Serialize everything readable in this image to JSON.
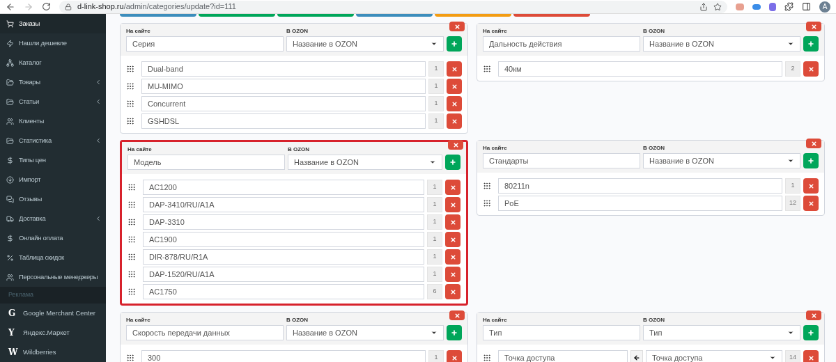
{
  "browser": {
    "url_host": "d-link-shop.ru",
    "url_path": "/admin/categories/update?id=111",
    "avatar": "A"
  },
  "sidebar": {
    "items": [
      {
        "label": "Заказы",
        "selected": true,
        "submenu": false
      },
      {
        "label": "Нашли дешевле",
        "selected": false,
        "submenu": false
      },
      {
        "label": "Каталог",
        "selected": false,
        "submenu": false
      },
      {
        "label": "Товары",
        "selected": false,
        "submenu": true
      },
      {
        "label": "Статьи",
        "selected": false,
        "submenu": true
      },
      {
        "label": "Клиенты",
        "selected": false,
        "submenu": false
      },
      {
        "label": "Статистика",
        "selected": false,
        "submenu": true
      },
      {
        "label": "Типы цен",
        "selected": false,
        "submenu": false
      },
      {
        "label": "Импорт",
        "selected": false,
        "submenu": false
      },
      {
        "label": "Отзывы",
        "selected": false,
        "submenu": false
      },
      {
        "label": "Доставка",
        "selected": false,
        "submenu": true
      },
      {
        "label": "Онлайн оплата",
        "selected": false,
        "submenu": false
      },
      {
        "label": "Таблица скидок",
        "selected": false,
        "submenu": false
      },
      {
        "label": "Персональные менеджеры",
        "selected": false,
        "submenu": false
      }
    ],
    "section": "Реклама",
    "ads_items": [
      {
        "glyph": "G",
        "label": "Google Merchant Center"
      },
      {
        "glyph": "Y",
        "label": "Яндекс.Маркет"
      },
      {
        "glyph": "W",
        "label": "Wildberries"
      }
    ]
  },
  "toolbar_buttons": [
    {
      "color": "#3c8dbc"
    },
    {
      "color": "#00a65a"
    },
    {
      "color": "#00a65a"
    },
    {
      "color": "#3c8dbc"
    },
    {
      "color": "#f39c12"
    },
    {
      "color": "#dd4b39"
    }
  ],
  "cards": [
    {
      "site_label": "На сайте",
      "ozon_label": "В OZON",
      "site_value": "Серия",
      "ozon_value": "Название в OZON",
      "highlighted": false,
      "rows": [
        {
          "kind": "plain",
          "value": "Dual-band",
          "count": "1"
        },
        {
          "kind": "plain",
          "value": "MU-MIMO",
          "count": "1"
        },
        {
          "kind": "plain",
          "value": "Concurrent",
          "count": "1"
        },
        {
          "kind": "plain",
          "value": "GSHDSL",
          "count": "1"
        }
      ]
    },
    {
      "site_label": "На сайте",
      "ozon_label": "В OZON",
      "site_value": "Дальность действия",
      "ozon_value": "Название в OZON",
      "highlighted": false,
      "rows": [
        {
          "kind": "plain",
          "value": "40км",
          "count": "2"
        }
      ]
    },
    {
      "site_label": "На сайте",
      "ozon_label": "В OZON",
      "site_value": "Модель",
      "ozon_value": "Название в OZON",
      "highlighted": true,
      "rows": [
        {
          "kind": "plain",
          "value": "AC1200",
          "count": "1"
        },
        {
          "kind": "plain",
          "value": "DAP-3410/RU/A1A",
          "count": "1"
        },
        {
          "kind": "plain",
          "value": "DAP-3310",
          "count": "1"
        },
        {
          "kind": "plain",
          "value": "AC1900",
          "count": "1"
        },
        {
          "kind": "plain",
          "value": "DIR-878/RU/R1A",
          "count": "1"
        },
        {
          "kind": "plain",
          "value": "DAP-1520/RU/A1A",
          "count": "1"
        },
        {
          "kind": "plain",
          "value": "AC1750",
          "count": "6"
        }
      ]
    },
    {
      "site_label": "На сайте",
      "ozon_label": "В OZON",
      "site_value": "Стандарты",
      "ozon_value": "Название в OZON",
      "highlighted": false,
      "rows": [
        {
          "kind": "plain",
          "value": "80211n",
          "count": "1"
        },
        {
          "kind": "plain",
          "value": "PoE",
          "count": "12"
        }
      ]
    },
    {
      "site_label": "На сайте",
      "ozon_label": "В OZON",
      "site_value": "Скорость передачи данных",
      "ozon_value": "Название в OZON",
      "highlighted": false,
      "rows": [
        {
          "kind": "plain",
          "value": "300",
          "count": "1"
        }
      ]
    },
    {
      "site_label": "На сайте",
      "ozon_label": "В OZON",
      "site_value": "Тип",
      "ozon_value": "Тип",
      "highlighted": false,
      "rows": [
        {
          "kind": "mapped",
          "value": "Точка доступа",
          "mapped_value": "Точка доступа",
          "count": "14"
        }
      ]
    }
  ]
}
